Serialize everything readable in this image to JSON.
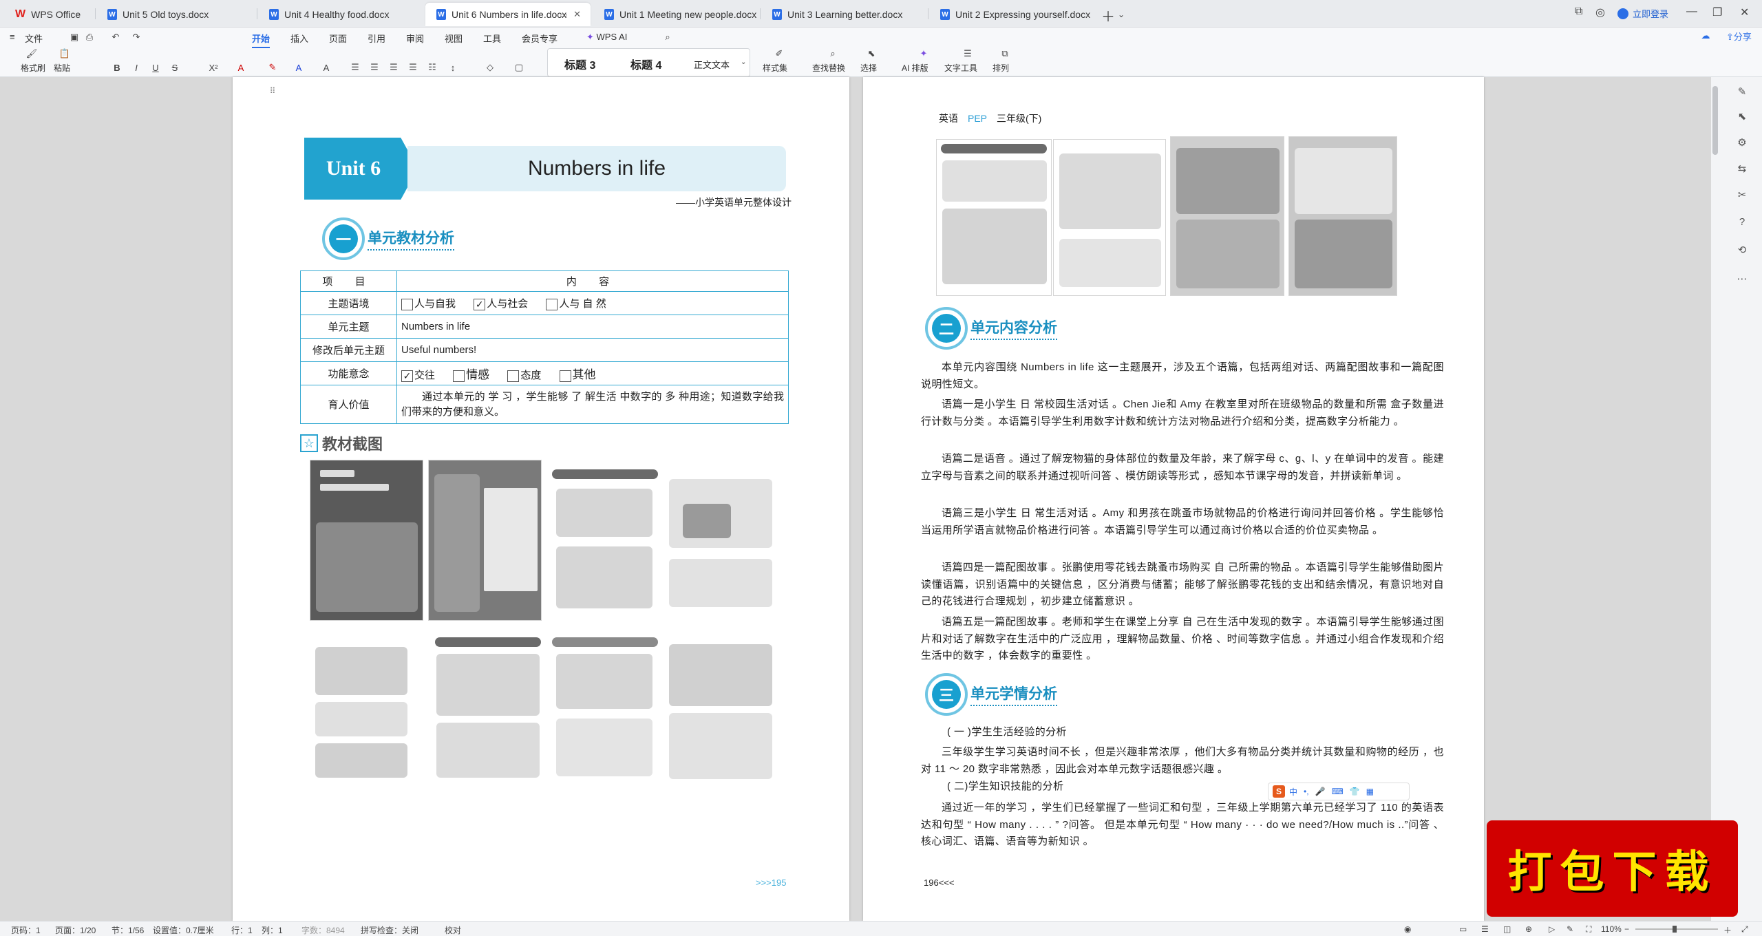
{
  "tabs": [
    {
      "label": "WPS Office",
      "active": false
    },
    {
      "label": "Unit 5 Old toys.docx",
      "active": false
    },
    {
      "label": "Unit 4 Healthy food.docx",
      "active": false
    },
    {
      "label": "Unit 6 Numbers in life.docx",
      "active": true
    },
    {
      "label": "Unit 1 Meeting new people.docx",
      "active": false
    },
    {
      "label": "Unit 3 Learning better.docx",
      "active": false
    },
    {
      "label": "Unit 2 Expressing yourself.docx",
      "active": false
    }
  ],
  "titlebar": {
    "login": "立即登录",
    "share": "分享"
  },
  "ribbon": {
    "menus": [
      "文件",
      "开始",
      "插入",
      "页面",
      "引用",
      "审阅",
      "视图",
      "工具",
      "会员专享",
      "WPS AI"
    ],
    "format_painter": "格式刷",
    "paste": "粘贴",
    "styles": [
      "标题 3",
      "标题 4",
      "正文文本"
    ],
    "style_set": "样式集",
    "find_replace": "查找替换",
    "select": "选择",
    "ai_layout": "AI 排版",
    "text_tools": "文字工具",
    "arrange": "排列"
  },
  "left_page": {
    "unit_tag": "Unit 6",
    "unit_title": "Numbers in life",
    "subtitle": "——小学英语单元整体设计",
    "section1_num": "一",
    "section1_title": "单元教材分析",
    "table": {
      "h_item": "项 目",
      "h_content": "内 容",
      "theme_label": "主题语境",
      "theme_opts": [
        {
          "label": "人与自我",
          "checked": false
        },
        {
          "label": "人与社会",
          "checked": true
        },
        {
          "label": "人与 自 然",
          "checked": false
        }
      ],
      "unit_theme_label": "单元主题",
      "unit_theme": "Numbers in life",
      "revised_label": "修改后单元主题",
      "revised": "Useful numbers!",
      "func_label": "功能意念",
      "func_opts": [
        {
          "label": "交往",
          "checked": true
        },
        {
          "label": "情感",
          "checked": false
        },
        {
          "label": "态度",
          "checked": false
        },
        {
          "label": "其他",
          "checked": false
        }
      ],
      "value_label": "育人价值",
      "value_text": "通过本单元的 学 习 ，学生能够 了 解生活 中数字的 多 种用途；知道数字给我们带来的方便和意义。"
    },
    "img_title": "教材截图",
    "page_num": ">>>195"
  },
  "right_page": {
    "header_en": "英语",
    "header_pep": "PEP",
    "header_grade": "三年级(下)",
    "section2_num": "二",
    "section2_title": "单元内容分析",
    "p1": "本单元内容围绕 Numbers in life 这一主题展开，涉及五个语篇，包括两组对话、两篇配图故事和一篇配图说明性短文。",
    "p2": "语篇一是小学生 日 常校园生活对话 。Chen Jie和 Amy 在教室里对所在班级物品的数量和所需 盒子数量进行计数与分类 。本语篇引导学生利用数字计数和统计方法对物品进行介绍和分类，提高数字分析能力 。",
    "p3": "语篇二是语音 。通过了解宠物猫的身体部位的数量及年龄，来了解字母 c、g、l、y 在单词中的发音 。能建立字母与音素之间的联系并通过视听问答 、模仿朗读等形式 ，感知本节课字母的发音，并拼读新单词 。",
    "p4": "语篇三是小学生 日 常生活对话 。Amy 和男孩在跳蚤市场就物品的价格进行询问并回答价格 。学生能够恰当运用所学语言就物品价格进行问答 。本语篇引导学生可以通过商讨价格以合适的价位买卖物品 。",
    "p5": "语篇四是一篇配图故事 。张鹏使用零花钱去跳蚤市场购买 自 己所需的物品 。本语篇引导学生能够借助图片读懂语篇，识别语篇中的关键信息 ，区分消费与储蓄；能够了解张鹏零花钱的支出和结余情况，有意识地对自 己的花钱进行合理规划 ，初步建立储蓄意识 。",
    "p6": "语篇五是一篇配图故事 。老师和学生在课堂上分享 自 己在生活中发现的数字 。本语篇引导学生能够通过图片和对话了解数字在生活中的广泛应用 ，理解物品数量、价格 、时间等数字信息 。并通过小组合作发现和介绍生活中的数字 ，体会数字的重要性 。",
    "section3_num": "三",
    "section3_title": "单元学情分析",
    "s1": "( 一 )学生生活经验的分析",
    "p7": "三年级学生学习英语时间不长 ，但是兴趣非常浓厚 ，他们大多有物品分类并统计其数量和购物的经历 ，也对 11 ～ 20 数字非常熟悉 ，因此会对本单元数字话题很感兴趣 。",
    "s2": "( 二)学生知识技能的分析",
    "p8": "通过近一年的学习 ，学生们已经掌握了一些词汇和句型 ，三年级上学期第六单元已经学习了 110 的英语表达和句型 “ How many . . . . ” ?问答。 但是本单元句型 “ How many · · · do we need?/How much is ..”问答 、核心词汇、语篇、语音等为新知识 。",
    "page_num": "196<<<"
  },
  "overlay": {
    "download": "打包下载",
    "ime": "中"
  },
  "status": {
    "page": "页码：1",
    "pages": "页面：1/20",
    "section": "节：1/56",
    "setting": "设置值：0.7厘米",
    "row": "行：1",
    "col": "列：1",
    "words": "字数：8494",
    "spell": "拼写检查：关闭",
    "proof": "校对",
    "zoom": "110%"
  }
}
